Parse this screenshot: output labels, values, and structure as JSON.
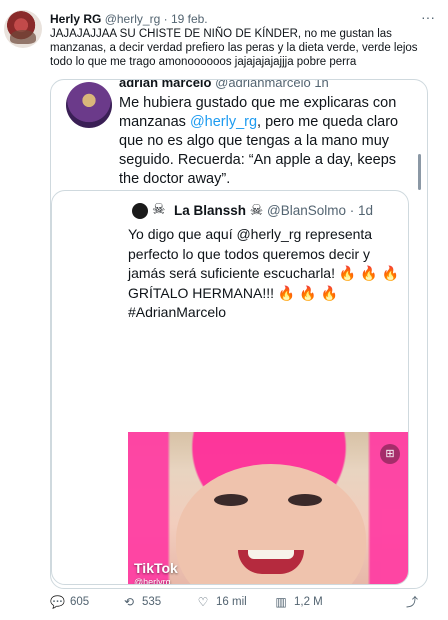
{
  "tweet": {
    "author_name": "Herly RG",
    "author_handle": "@herly_rg",
    "date_sep": "·",
    "date": "19 feb.",
    "text": "JAJAJAJJAA SU CHISTE DE NIÑO DE KÍNDER, no me gustan las manzanas, a decir verdad prefiero las peras y la dieta verde, verde lejos todo lo que me trago amonoooooos jajajajajajjja pobre perra",
    "more_icon": "more-icon"
  },
  "quote": {
    "author_name": "adrian marcelo",
    "author_handle": "@adrianmarcelo",
    "time": "1h",
    "text_parts": {
      "before": "Me hubiera gustado que me explicaras con manzanas ",
      "mention": "@herly_rg",
      "after": ", pero me queda claro que no es algo que tengas a la mano muy seguido. Recuerda: “An apple a day, keeps the doctor away”."
    }
  },
  "nested": {
    "author_name": "La Blanssh",
    "author_handle": "@BlanSolmo",
    "time": "1d",
    "skull_emoji": "☠",
    "text": "Yo digo que aquí @herly_rg representa perfecto lo que todos queremos decir y jamás será suficiente escucharla! 🔥 🔥 🔥 GRÍTALO HERMANA!!! 🔥 🔥 🔥 #AdrianMarcelo",
    "media": {
      "watermark_logo": "TikTok",
      "watermark_handle": "@herlyrg",
      "badge": "⊞"
    }
  },
  "actions": {
    "replies": "605",
    "retweets": "535",
    "likes": "16 mil",
    "views": "1,2 M",
    "icons": [
      "reply-icon",
      "retweet-icon",
      "like-icon",
      "views-icon",
      "share-icon"
    ]
  },
  "colors": {
    "link": "#1d9bf0",
    "muted": "#536471",
    "border": "#cfd9de"
  }
}
